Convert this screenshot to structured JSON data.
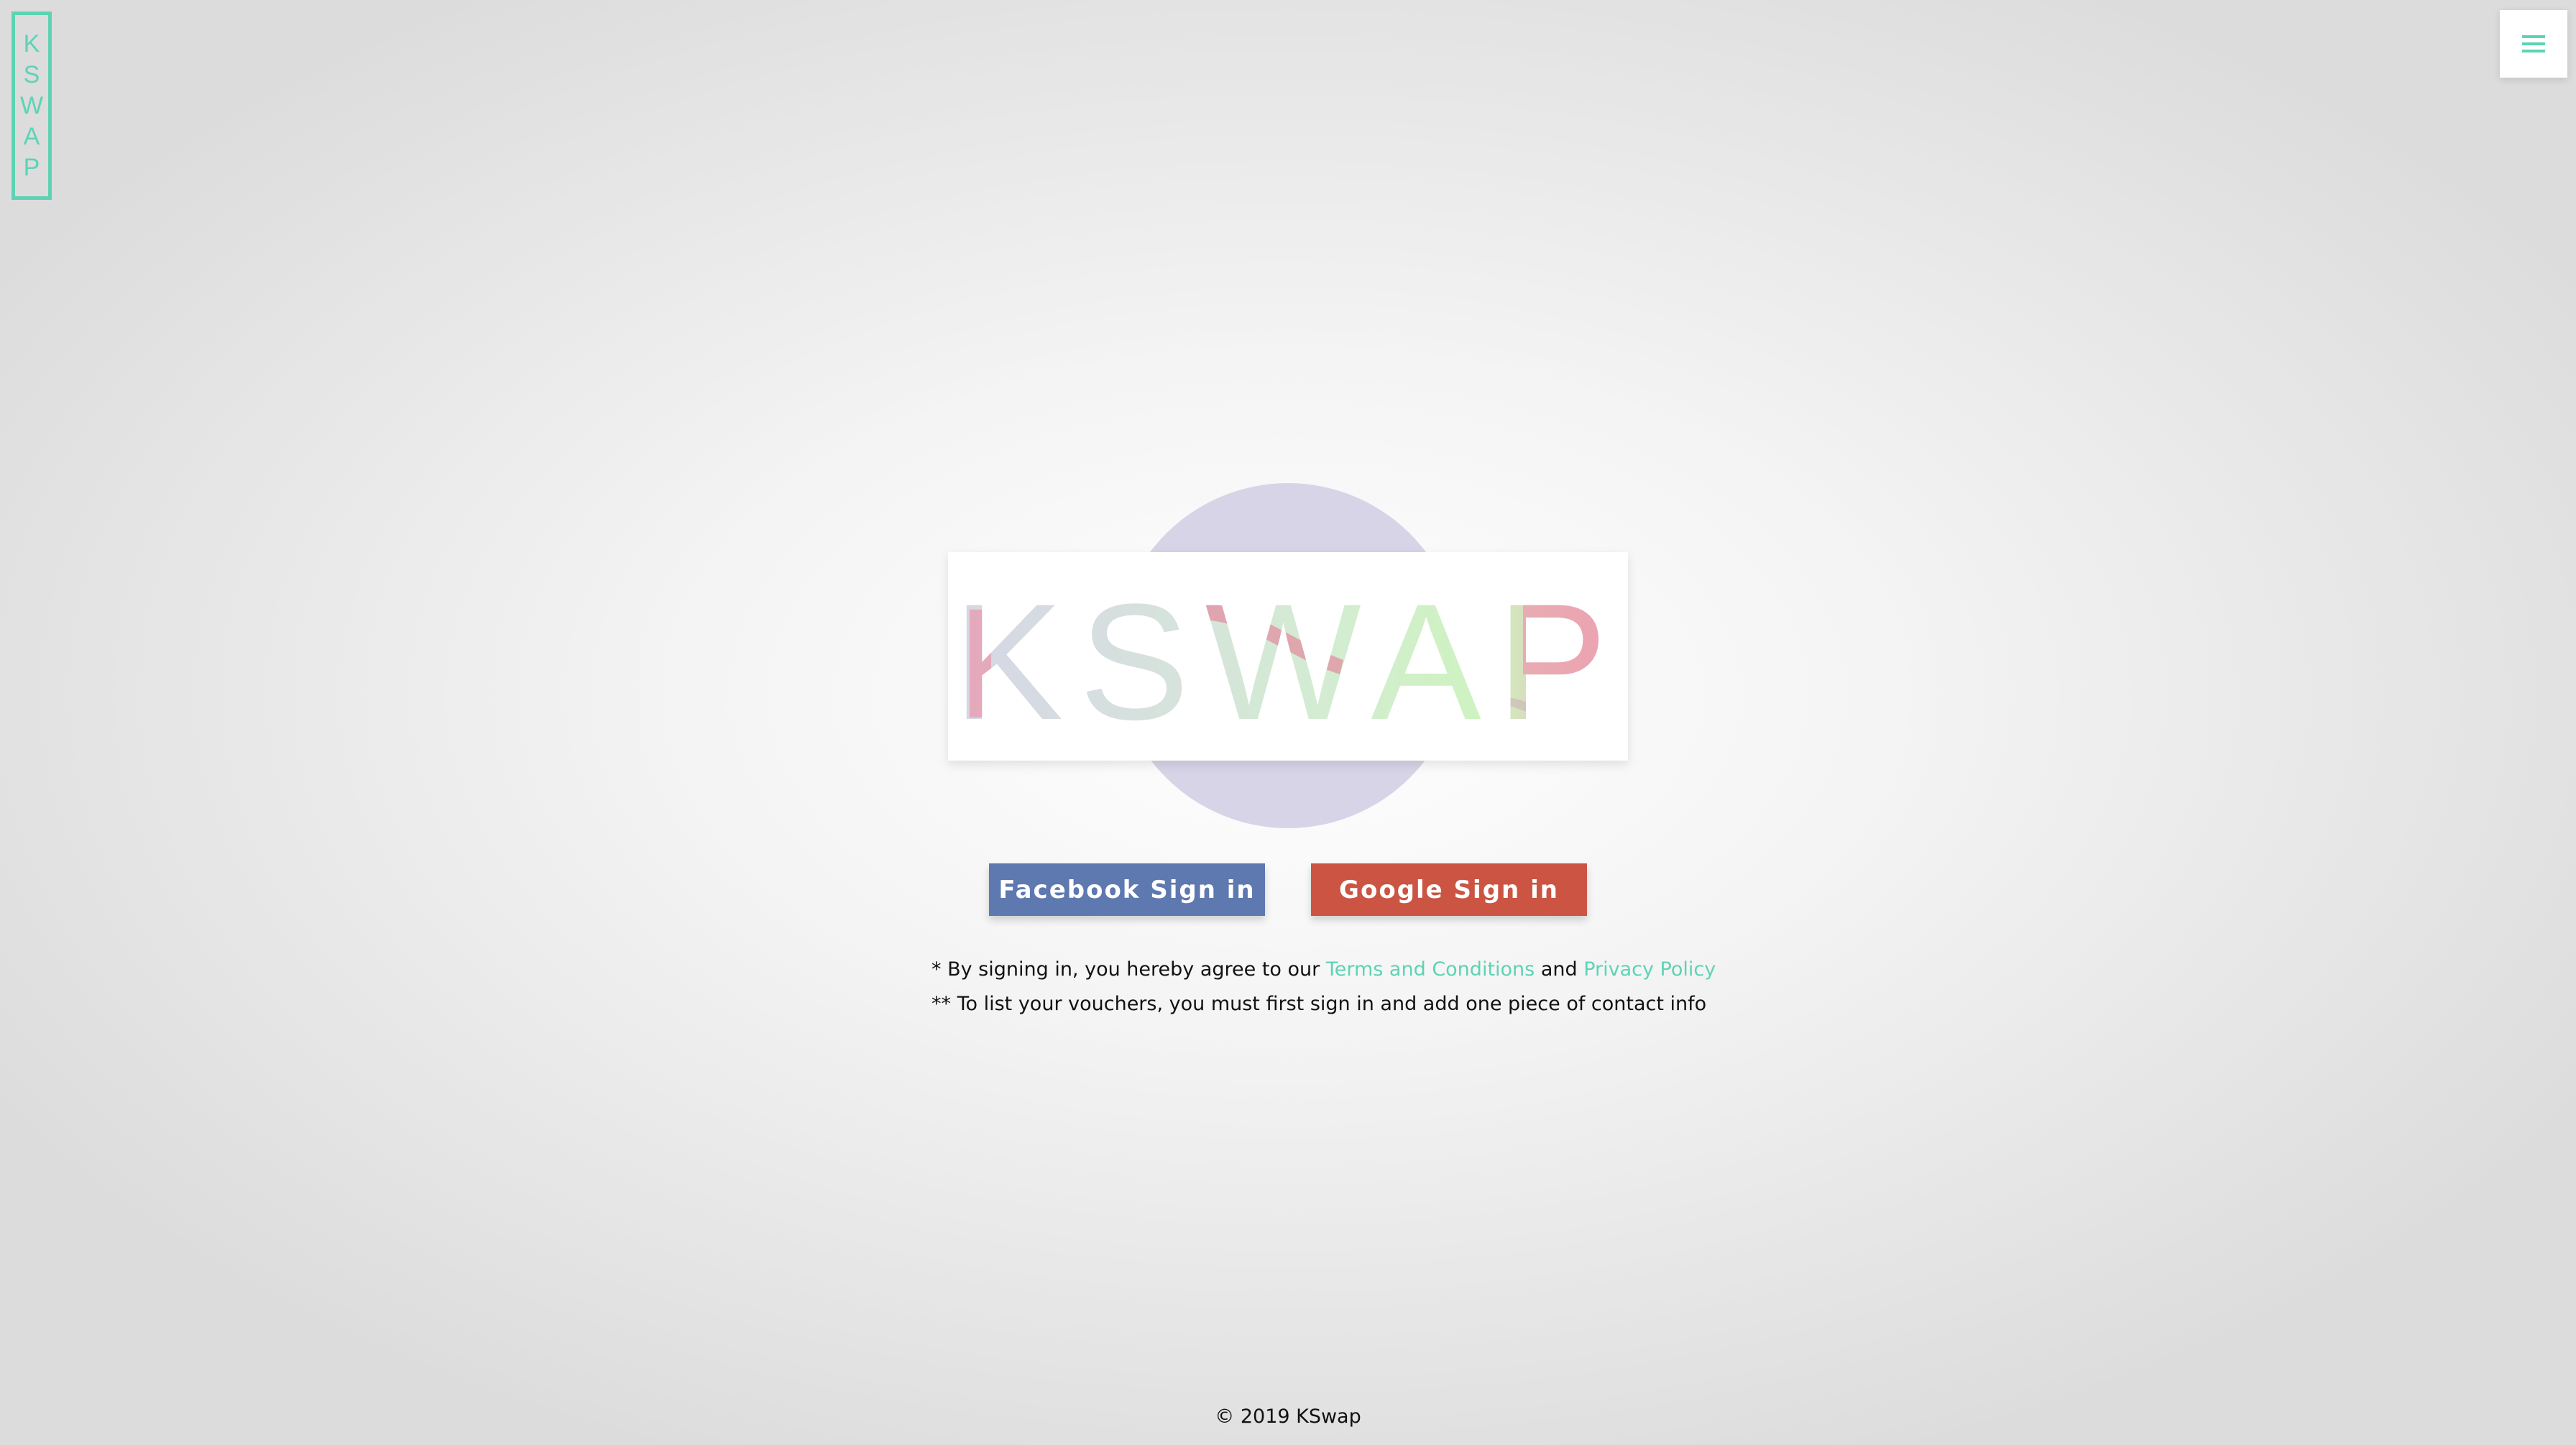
{
  "brand": {
    "side_letters": [
      "K",
      "S",
      "W",
      "A",
      "P"
    ],
    "hero_text": "KSWAP",
    "accent_color": "#5ed3b4"
  },
  "menu": {
    "icon": "hamburger-icon"
  },
  "buttons": {
    "facebook_label": "Facebook Sign in",
    "facebook_color": "#5e78b0",
    "google_label": "Google Sign in",
    "google_color": "#cb5443"
  },
  "notes": {
    "line1_prefix": "* By signing in, you hereby agree to our ",
    "terms_link": "Terms and Conditions",
    "line1_and": " and ",
    "privacy_link": "Privacy Policy",
    "line2": "** To list your vouchers, you must first sign in and add one piece of contact info"
  },
  "footer": {
    "copyright": "© 2019 KSwap"
  }
}
